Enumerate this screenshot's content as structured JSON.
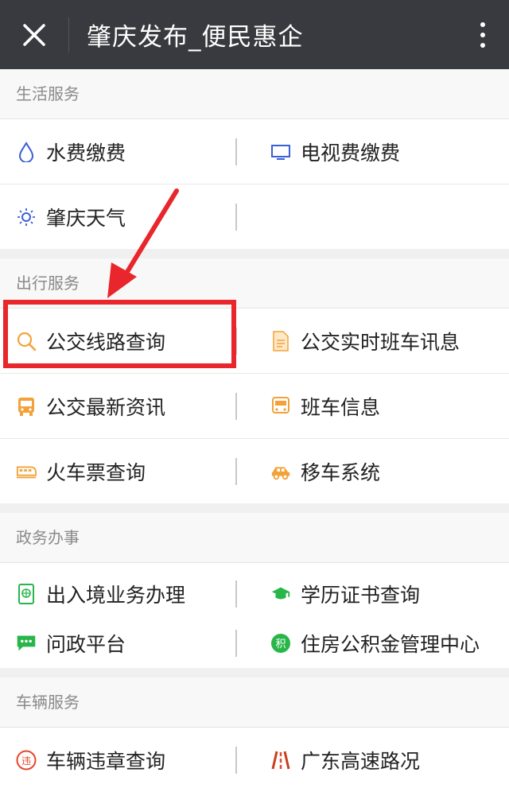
{
  "header": {
    "title": "肇庆发布_便民惠企"
  },
  "sections": [
    {
      "title": "生活服务",
      "items": [
        "水费缴费",
        "电视费缴费",
        "肇庆天气"
      ]
    },
    {
      "title": "出行服务",
      "items": [
        "公交线路查询",
        "公交实时班车讯息",
        "公交最新资讯",
        "班车信息",
        "火车票查询",
        "移车系统"
      ]
    },
    {
      "title": "政务办事",
      "items": [
        "出入境业务办理",
        "学历证书查询",
        "问政平台",
        "住房公积金管理中心"
      ]
    },
    {
      "title": "车辆服务",
      "items": [
        "车辆违章查询",
        "广东高速路况"
      ]
    }
  ],
  "colors": {
    "topbar": "#393a3f",
    "highlight": "#e8262b",
    "orange": "#f3a23a",
    "green": "#28b64a",
    "blue": "#3a5fd6"
  }
}
